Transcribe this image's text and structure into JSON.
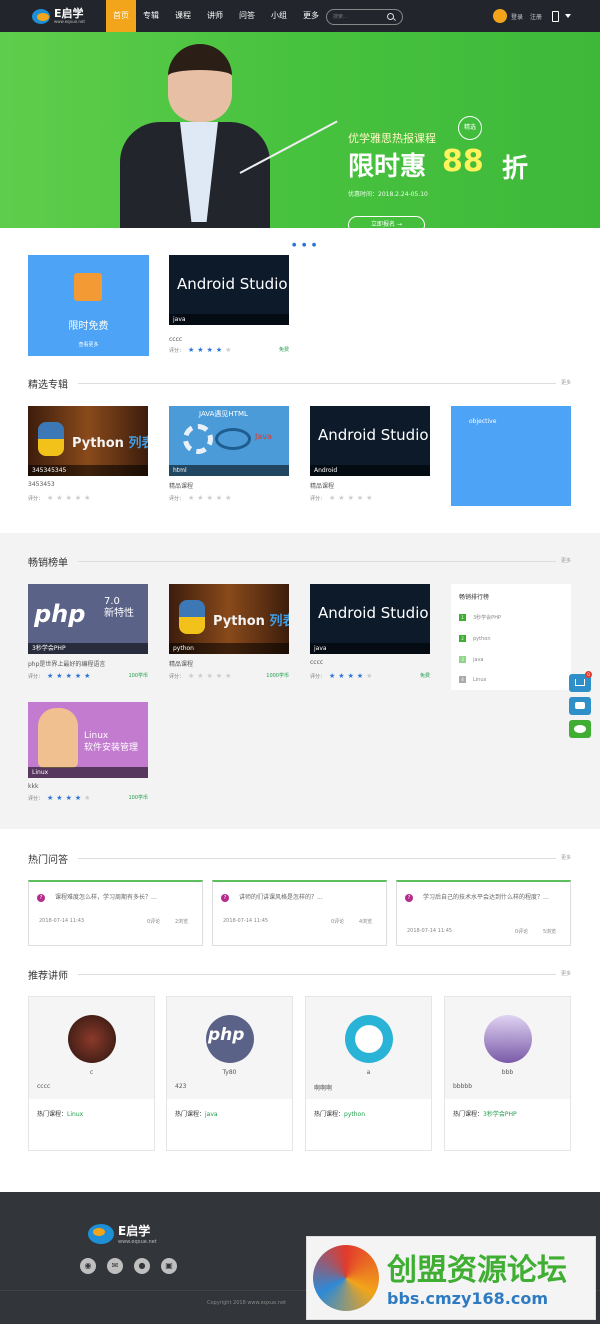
{
  "header": {
    "logo_text": "E启学",
    "logo_url": "www.eqxue.net",
    "nav": [
      "首页",
      "专辑",
      "课程",
      "讲师",
      "问答",
      "小组",
      "更多"
    ],
    "search_placeholder": "搜索...",
    "login": "登录",
    "register": "注册"
  },
  "banner": {
    "subtitle": "优学雅思热报课程",
    "badge": "精选",
    "title": "限时惠",
    "discount": "88",
    "discount_unit": "折",
    "time": "优惠时间：2018.2.24-05.10",
    "button": "立即报名 →"
  },
  "free_block": {
    "title": "限时免费",
    "more": "查看更多"
  },
  "free_course": {
    "tag": "java",
    "title": "cccc",
    "rating_label": "评分：",
    "rating": 4,
    "price": "免费"
  },
  "featured": {
    "title": "精选专辑",
    "more": "更多",
    "items": [
      {
        "tag": "345345345",
        "title": "3453453",
        "rating": 0
      },
      {
        "tag": "html",
        "title": "精品课程",
        "rating": 0
      },
      {
        "tag": "Android",
        "title": "精品课程",
        "rating": 0
      },
      {
        "tag": "objective",
        "title": "",
        "rating": 0
      }
    ]
  },
  "bestseller": {
    "title": "畅销榜单",
    "more": "更多",
    "items": [
      {
        "tag": "3秒学会PHP",
        "title": "php是世界上最好的编程语言",
        "rating": 5,
        "price": "100学币"
      },
      {
        "tag": "python",
        "title": "精品课程",
        "rating": 0,
        "price": "1000学币"
      },
      {
        "tag": "java",
        "title": "cccc",
        "rating": 4,
        "price": "免费"
      },
      {
        "tag": "Linux",
        "title": "kkk",
        "rating": 4,
        "price": "100学币"
      }
    ],
    "ranking": {
      "title": "畅销排行榜",
      "items": [
        "3秒学会PHP",
        "python",
        "java",
        "Linux"
      ]
    }
  },
  "qa": {
    "title": "热门问答",
    "more": "更多",
    "items": [
      {
        "question": "课程难度怎么样，学习周期有多长？...",
        "date": "2018-07-14 11:43",
        "comments": "0评论",
        "views": "2浏览"
      },
      {
        "question": "讲师的们讲课风格是怎样的？...",
        "date": "2018-07-14 11:45",
        "comments": "0评论",
        "views": "4浏览"
      },
      {
        "question": "学习后自己的技术水平会达到什么样的程度？...",
        "date": "2018-07-14 11:45",
        "comments": "0评论",
        "views": "5浏览"
      }
    ]
  },
  "teachers": {
    "title": "推荐讲师",
    "more": "更多",
    "course_label": "热门课程：",
    "items": [
      {
        "name": "c",
        "desc": "cccc",
        "course": "Linux"
      },
      {
        "name": "Ty80",
        "desc": "423",
        "course": "java"
      },
      {
        "name": "a",
        "desc": "啊啊啊",
        "course": "python"
      },
      {
        "name": "bbb",
        "desc": "bbbbb",
        "course": "3秒学会PHP"
      }
    ]
  },
  "footer": {
    "logo_text": "E启学",
    "logo_url": "www.eqxue.net",
    "copyright": "Copyright 2018 www.eqxue.net"
  },
  "watermark": {
    "title": "创盟资源论坛",
    "url": "bbs.cmzy168.com"
  },
  "thumbs": {
    "android": "Android Studio",
    "python": "Python",
    "python_cn": "列表",
    "php": "php",
    "php_ver": "7.0",
    "php_feature": "新特性",
    "html": "JAVA遇见HTML",
    "linux": "Linux",
    "linux_cn": "软件安装管理"
  },
  "side_cart_count": "0",
  "colors": {
    "accent": "#f2a51a",
    "green": "#47c23e",
    "star": "#2b74d8",
    "blue": "#4da3f5"
  }
}
